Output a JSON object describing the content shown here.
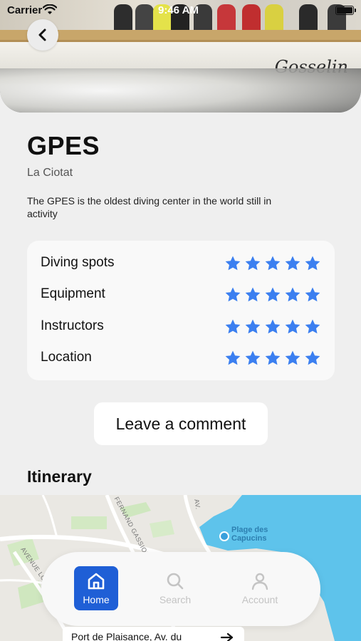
{
  "status_bar": {
    "carrier": "Carrier",
    "time": "9:46 AM"
  },
  "hero": {
    "hull_text": "Gosselin"
  },
  "center": {
    "name": "GPES",
    "city": "La Ciotat",
    "description": "The GPES is the oldest diving center in the world still in activity"
  },
  "ratings": [
    {
      "label": "Diving spots",
      "stars": 5
    },
    {
      "label": "Equipment",
      "stars": 5
    },
    {
      "label": "Instructors",
      "stars": 5
    },
    {
      "label": "Location",
      "stars": 5
    }
  ],
  "comment_button_label": "Leave a comment",
  "itinerary_title": "Itinerary",
  "map": {
    "place_label_line1": "Plage des",
    "place_label_line2": "Capucins",
    "street_1": "AVENUE LOU",
    "street_2": "FERNAND GASSION",
    "street_3": "AV."
  },
  "tab_bar": {
    "home": "Home",
    "search": "Search",
    "account": "Account"
  },
  "address": "Port de Plaisance, Av. du",
  "colors": {
    "accent": "#1f5fd6",
    "star": "#3b7ff0",
    "sea": "#5ec3eb",
    "inactive_tab": "#c4c4c4"
  }
}
